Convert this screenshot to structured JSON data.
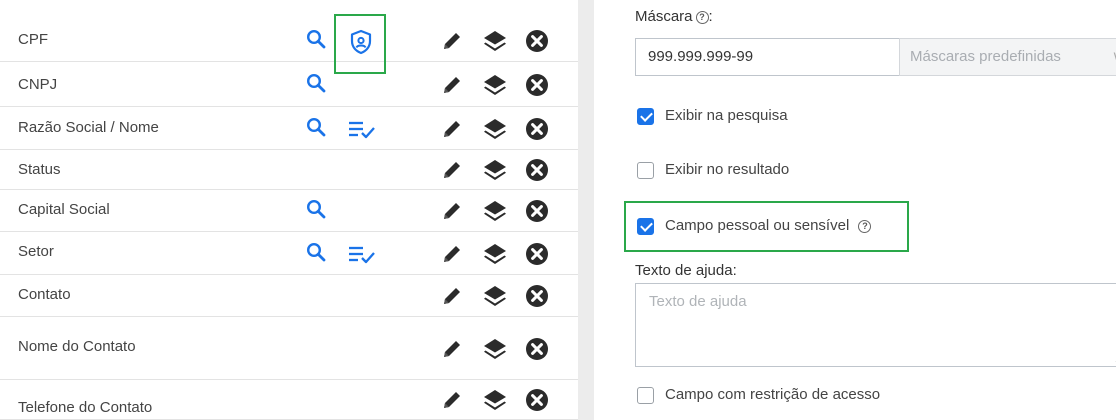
{
  "fields": [
    {
      "label": "CPF",
      "search": true,
      "shield": true,
      "list": false
    },
    {
      "label": "CNPJ",
      "search": true,
      "shield": false,
      "list": false
    },
    {
      "label": "Razão Social / Nome",
      "search": true,
      "shield": false,
      "list": true
    },
    {
      "label": "Status",
      "search": false,
      "shield": false,
      "list": false
    },
    {
      "label": "Capital Social",
      "search": true,
      "shield": false,
      "list": false
    },
    {
      "label": "Setor",
      "search": true,
      "shield": false,
      "list": true
    },
    {
      "label": "Contato",
      "search": false,
      "shield": false,
      "list": false
    },
    {
      "label": "Nome do Contato",
      "search": false,
      "shield": false,
      "list": false
    },
    {
      "label": "Telefone do Contato",
      "search": false,
      "shield": false,
      "list": false
    }
  ],
  "icons": {
    "search": "search-icon",
    "shield": "privacy-shield-icon",
    "list": "list-check-icon",
    "edit": "pencil-icon",
    "layers": "layers-icon",
    "remove": "remove-circle-icon"
  },
  "colors": {
    "accent": "#1a73e8",
    "highlight": "#2aa84a",
    "action_icons": "#2b2b2b"
  },
  "form": {
    "mask_label": "Máscara",
    "mask_label_suffix": ":",
    "help_glyph": "?",
    "mask_value": "999.999.999-99",
    "mask_preset_placeholder": "Máscaras predefinidas",
    "chevron_glyph": "∨",
    "show_in_search": {
      "label": "Exibir na pesquisa",
      "checked": true
    },
    "show_in_result": {
      "label": "Exibir no resultado",
      "checked": false
    },
    "sensitive_field": {
      "label": "Campo pessoal ou sensível",
      "checked": true
    },
    "help_text_label": "Texto de ajuda:",
    "help_text_placeholder": "Texto de ajuda",
    "restricted_access": {
      "label": "Campo com restrição de acesso",
      "checked": false
    }
  }
}
